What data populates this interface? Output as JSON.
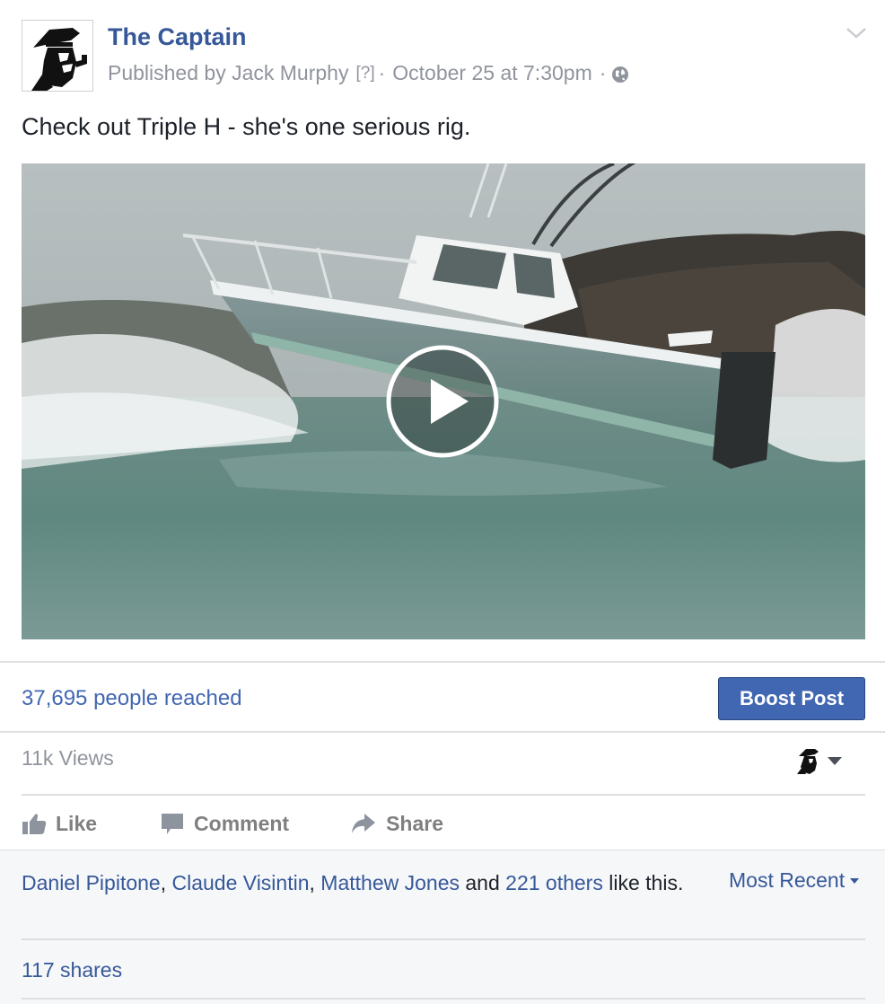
{
  "post": {
    "page_name": "The Captain",
    "published_by": "Published by Jack Murphy",
    "help_marker": "[?]",
    "separator": "·",
    "timestamp": "October 25 at 7:30pm",
    "text": "Check out Triple H - she's one serious rig.",
    "icons": {
      "avatar": "captain-avatar",
      "privacy": "globe-icon",
      "menu": "chevron-down-icon",
      "play": "play-icon"
    }
  },
  "insights": {
    "reach": "37,695 people reached",
    "boost_label": "Boost Post",
    "views": "11k Views"
  },
  "actions": {
    "like": "Like",
    "comment": "Comment",
    "share": "Share"
  },
  "likes": {
    "names": [
      "Daniel Pipitone",
      "Claude Visintin",
      "Matthew Jones"
    ],
    "comma": ",",
    "and_text": "and",
    "others": "221 others",
    "suffix": "like this."
  },
  "sort_label": "Most Recent",
  "shares": "117 shares",
  "colors": {
    "link": "#365899",
    "button": "#4267b2",
    "muted": "#90949c",
    "footer_bg": "#f6f7f9"
  }
}
